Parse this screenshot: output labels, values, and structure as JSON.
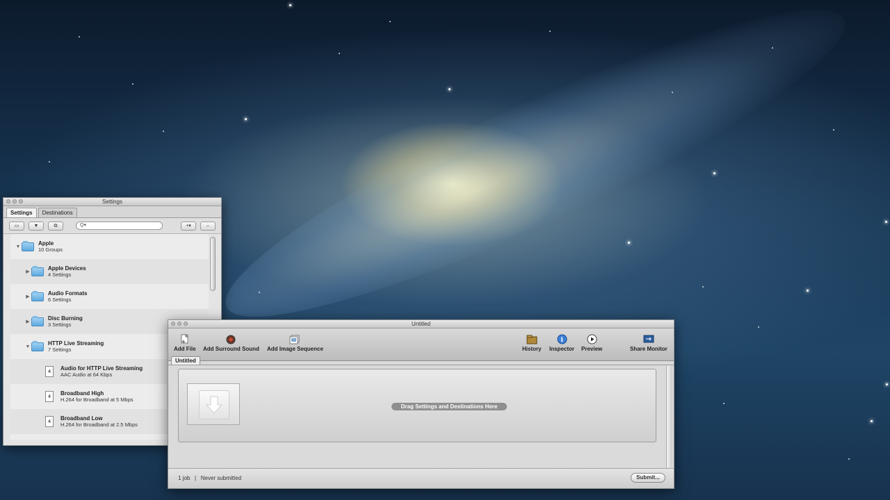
{
  "settings_window": {
    "title": "Settings",
    "tabs": [
      "Settings",
      "Destinations"
    ],
    "search_placeholder": "Q▾",
    "add_label": "+▾",
    "remove_label": "–",
    "tree": [
      {
        "title": "Apple",
        "subtitle": "10 Groups",
        "type": "folder",
        "expanded": true,
        "level": 0
      },
      {
        "title": "Apple Devices",
        "subtitle": "4 Settings",
        "type": "folder",
        "expanded": false,
        "level": 1
      },
      {
        "title": "Audio Formats",
        "subtitle": "6 Settings",
        "type": "folder",
        "expanded": false,
        "level": 1
      },
      {
        "title": "Disc Burning",
        "subtitle": "3 Settings",
        "type": "folder",
        "expanded": false,
        "level": 1
      },
      {
        "title": "HTTP Live Streaming",
        "subtitle": "7 Settings",
        "type": "folder",
        "expanded": true,
        "level": 1
      },
      {
        "title": "Audio for HTTP Live Streaming",
        "subtitle": "AAC Audio at 64 Kbps",
        "type": "setting",
        "level": 2
      },
      {
        "title": "Broadband High",
        "subtitle": "H.264 for Broadband at 5 Mbps",
        "type": "setting",
        "level": 2
      },
      {
        "title": "Broadband Low",
        "subtitle": "H.264 for Broadband at 2.5 Mbps",
        "type": "setting",
        "level": 2
      }
    ]
  },
  "batch_window": {
    "title": "Untitled",
    "toolbar": {
      "add_file": "Add File",
      "add_surround": "Add Surround Sound",
      "add_image_sequence": "Add Image Sequence",
      "history": "History",
      "inspector": "Inspector",
      "preview": "Preview",
      "share_monitor": "Share Monitor"
    },
    "tab": "Untitled",
    "drop_label": "Drag Settings and Destinations Here",
    "status": {
      "jobs": "1 job",
      "separator": "|",
      "submitted": "Never submitted"
    },
    "submit_label": "Submit..."
  },
  "colors": {
    "folder": "#5da9df",
    "desktop": "#173552"
  }
}
